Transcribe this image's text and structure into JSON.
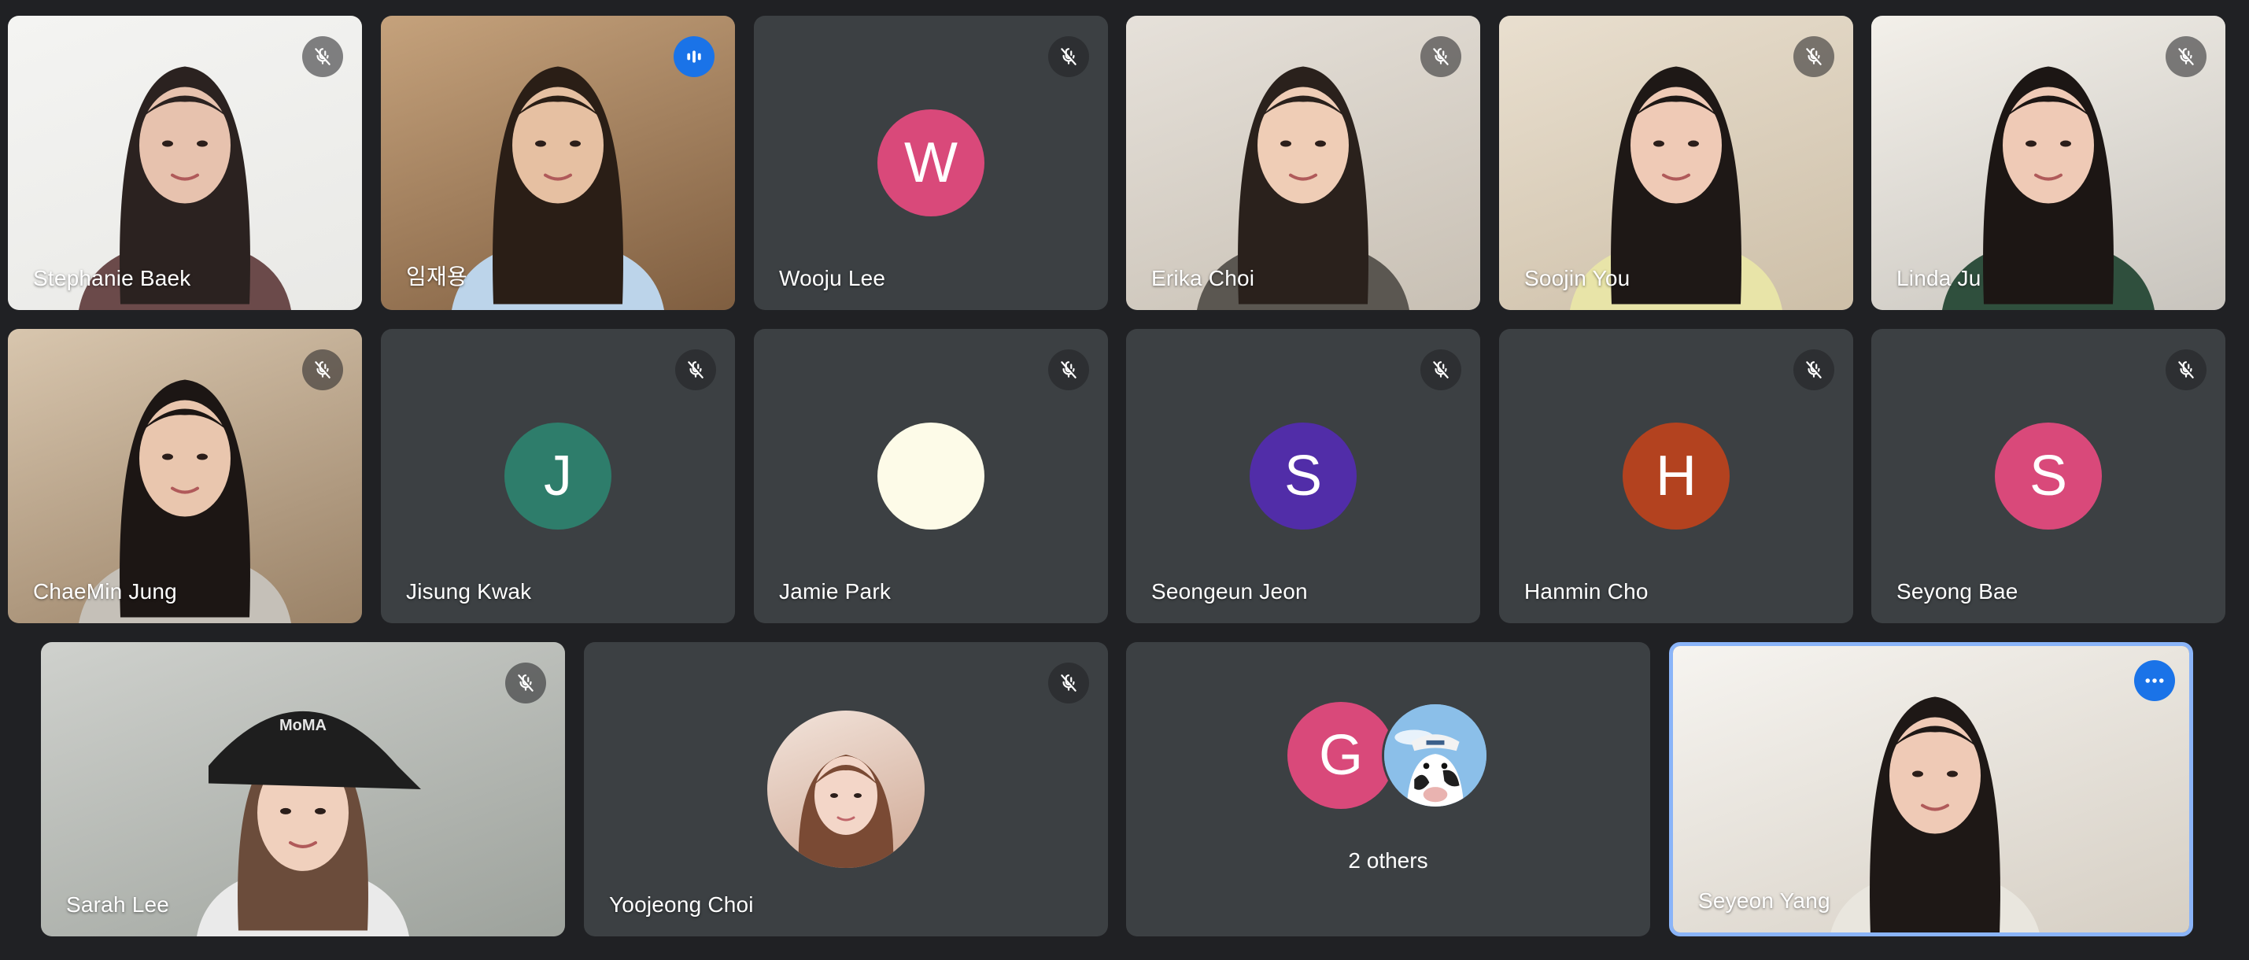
{
  "participants": [
    {
      "name": "Stephanie Baek",
      "mic": "muted",
      "type": "video",
      "bg": [
        "#f4f4f2",
        "#e9e9e6"
      ],
      "hair": "#2b2220",
      "skin": "#e7c2ae",
      "shirt": "#6b4a4a"
    },
    {
      "name": "임재용",
      "mic": "speaking",
      "type": "video",
      "bg": [
        "#c5a27c",
        "#7f5e40"
      ],
      "hair": "#2a1e16",
      "skin": "#e6c0a2",
      "shirt": "#bcd4ea"
    },
    {
      "name": "Wooju Lee",
      "mic": "muted",
      "type": "avatar",
      "initial": "W",
      "color": "#d9497a"
    },
    {
      "name": "Erika Choi",
      "mic": "muted",
      "type": "video",
      "bg": [
        "#e6e1da",
        "#c8c0b4"
      ],
      "hair": "#2a211c",
      "skin": "#efcdb6",
      "shirt": "#5b5751"
    },
    {
      "name": "Soojin You",
      "mic": "muted",
      "type": "video",
      "bg": [
        "#e9dfcf",
        "#cdbfa8"
      ],
      "hair": "#1e1816",
      "skin": "#efcab6",
      "shirt": "#e8e4a8"
    },
    {
      "name": "Linda Ju",
      "mic": "muted",
      "type": "video",
      "bg": [
        "#f3f0ea",
        "#c8c4bd"
      ],
      "hair": "#1c1614",
      "skin": "#efcab6",
      "shirt": "#2f4f3d"
    },
    {
      "name": "ChaeMin Jung",
      "mic": "muted",
      "type": "video",
      "bg": [
        "#d8c6ae",
        "#9a8267"
      ],
      "hair": "#1c1614",
      "skin": "#e9c6ae",
      "shirt": "#c5c0b8"
    },
    {
      "name": "Jisung Kwak",
      "mic": "muted",
      "type": "avatar",
      "initial": "J",
      "color": "#2e7d6b"
    },
    {
      "name": "Jamie Park",
      "mic": "muted",
      "type": "avatar",
      "initial": "",
      "color": "#fdfbe8"
    },
    {
      "name": "Seongeun Jeon",
      "mic": "muted",
      "type": "avatar",
      "initial": "S",
      "color": "#512da8"
    },
    {
      "name": "Hanmin Cho",
      "mic": "muted",
      "type": "avatar",
      "initial": "H",
      "color": "#b3421f"
    },
    {
      "name": "Seyong Bae",
      "mic": "muted",
      "type": "avatar",
      "initial": "S",
      "color": "#d9497a"
    },
    {
      "name": "Sarah Lee",
      "mic": "muted",
      "type": "video",
      "bg": [
        "#cfd1cd",
        "#9da29c"
      ],
      "hair": "#6b4c3b",
      "skin": "#f0d0bd",
      "shirt": "#eaeaea",
      "cap": "#1e1e1e",
      "cap_text": "MoMA"
    },
    {
      "name": "Yoojeong Choi",
      "mic": "muted",
      "type": "photo-avatar",
      "bg": [
        "#f2e3da",
        "#cfa894"
      ],
      "hair": "#7a4a34",
      "skin": "#f3d6c8"
    },
    {
      "name": "Seyeon Yang",
      "mic": "self",
      "type": "video",
      "bg": [
        "#f6f4f0",
        "#d6cfc4"
      ],
      "hair": "#1e1816",
      "skin": "#efcab6",
      "shirt": "#e9e6de"
    }
  ],
  "others": {
    "label": "2 others",
    "initial": "G",
    "color": "#d9497a"
  },
  "icons": {
    "mic_off": "mic-off-icon",
    "speaking": "audio-level-icon",
    "more": "more-options-icon"
  }
}
